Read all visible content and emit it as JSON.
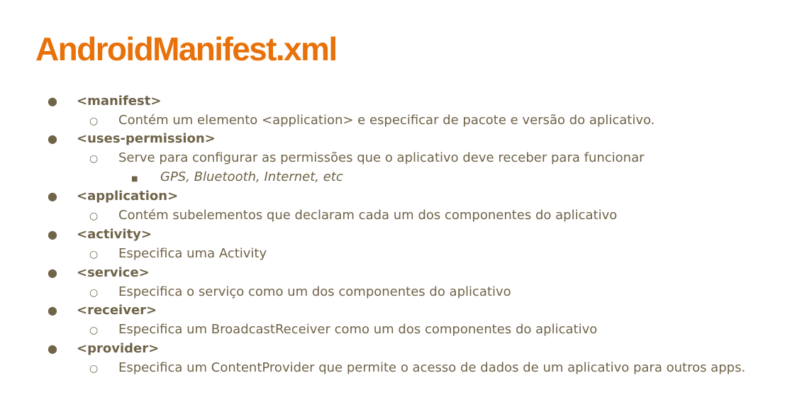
{
  "slide": {
    "title": "AndroidManifest.xml",
    "bullets": {
      "l1": "●",
      "l2": "○",
      "l3": "■"
    },
    "items": [
      {
        "level": 1,
        "text": "<manifest>"
      },
      {
        "level": 2,
        "text": "Contém um elemento <application> e especificar de pacote e versão do aplicativo."
      },
      {
        "level": 1,
        "text": "<uses-permission>"
      },
      {
        "level": 2,
        "text": "Serve para configurar as permissões que o aplicativo deve receber para funcionar"
      },
      {
        "level": 3,
        "text": "GPS, Bluetooth, Internet, etc"
      },
      {
        "level": 1,
        "text": "<application>"
      },
      {
        "level": 2,
        "text": "Contém subelementos que declaram cada um dos componentes do aplicativo"
      },
      {
        "level": 1,
        "text": "<activity>"
      },
      {
        "level": 2,
        "text": "Especifica uma Activity"
      },
      {
        "level": 1,
        "text": "<service>"
      },
      {
        "level": 2,
        "text": "Especifica o serviço como um dos componentes do aplicativo"
      },
      {
        "level": 1,
        "text": "<receiver>"
      },
      {
        "level": 2,
        "text": "Especifica um BroadcastReceiver como um dos componentes do aplicativo"
      },
      {
        "level": 1,
        "text": "<provider>"
      },
      {
        "level": 2,
        "text": "Especifica um ContentProvider que permite o acesso de dados de um aplicativo para outros apps."
      }
    ],
    "colors": {
      "title": "#e8710a",
      "body": "#6f6348"
    }
  }
}
